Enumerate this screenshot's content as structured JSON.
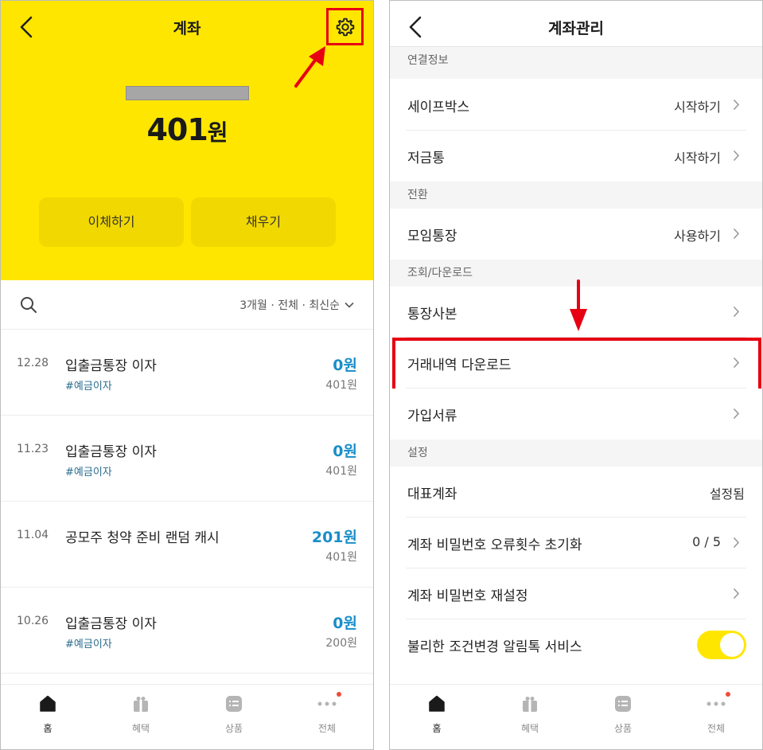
{
  "left": {
    "title": "계좌",
    "balance_number": "401",
    "balance_unit": "원",
    "buttons": {
      "transfer": "이체하기",
      "fill": "채우기"
    },
    "filter": "3개월 · 전체 · 최신순",
    "transactions": [
      {
        "date": "12.28",
        "title": "입출금통장 이자",
        "tag": "#예금이자",
        "amount": "0원",
        "balance": "401원"
      },
      {
        "date": "11.23",
        "title": "입출금통장 이자",
        "tag": "#예금이자",
        "amount": "0원",
        "balance": "401원"
      },
      {
        "date": "11.04",
        "title": "공모주 청약 준비 랜덤 캐시",
        "tag": "",
        "amount": "201원",
        "balance": "401원"
      },
      {
        "date": "10.26",
        "title": "입출금통장 이자",
        "tag": "#예금이자",
        "amount": "0원",
        "balance": "200원"
      }
    ]
  },
  "nav": {
    "home": "홈",
    "benefits": "혜택",
    "products": "상품",
    "all": "전체"
  },
  "right": {
    "title": "계좌관리",
    "sections": {
      "connection": "연결정보",
      "conversion": "전환",
      "inquiry": "조회/다운로드",
      "settings": "설정"
    },
    "rows": {
      "safebox": {
        "label": "세이프박스",
        "value": "시작하기"
      },
      "piggy": {
        "label": "저금통",
        "value": "시작하기"
      },
      "group": {
        "label": "모임통장",
        "value": "사용하기"
      },
      "copy": {
        "label": "통장사본"
      },
      "download": {
        "label": "거래내역 다운로드"
      },
      "docs": {
        "label": "가입서류"
      },
      "representative": {
        "label": "대표계좌",
        "value": "설정됨"
      },
      "pw_reset_count": {
        "label": "계좌 비밀번호 오류횟수 초기화",
        "value": "0 / 5"
      },
      "pw_reset": {
        "label": "계좌 비밀번호 재설정"
      },
      "alert": {
        "label": "불리한 조건변경 알림톡 서비스",
        "toggle_on": true
      }
    }
  },
  "colors": {
    "brand_yellow": "#ffe600",
    "amount_blue": "#1a8ec8",
    "highlight_red": "#e60012"
  }
}
